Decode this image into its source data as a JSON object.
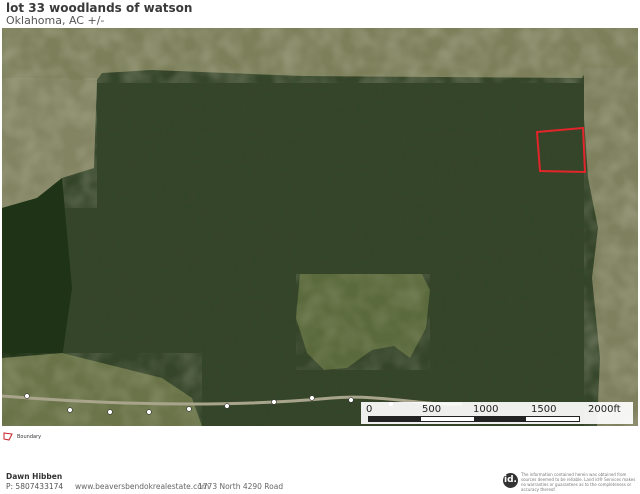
{
  "header": {
    "title": "lot 33 woodlands of watson",
    "subtitle": "Oklahoma,  AC +/-"
  },
  "map": {
    "boundary_color": "#e2242b",
    "scale": {
      "labels": [
        "0",
        "500",
        "1000",
        "1500",
        "2000ft"
      ]
    }
  },
  "legend": {
    "icon": "boundary-polygon-icon",
    "label": "Boundary"
  },
  "footer": {
    "agent_name": "Dawn Hibben",
    "phone": "P: 5807433174",
    "website": "www.beaversbendokrealestate.com",
    "address": "1773 North 4290 Road",
    "logo_text": "id.",
    "disclaimer": "The information contained herein was obtained from sources deemed to be reliable. Land id® Services makes no warranties or guarantees as to the completeness or accuracy thereof."
  }
}
